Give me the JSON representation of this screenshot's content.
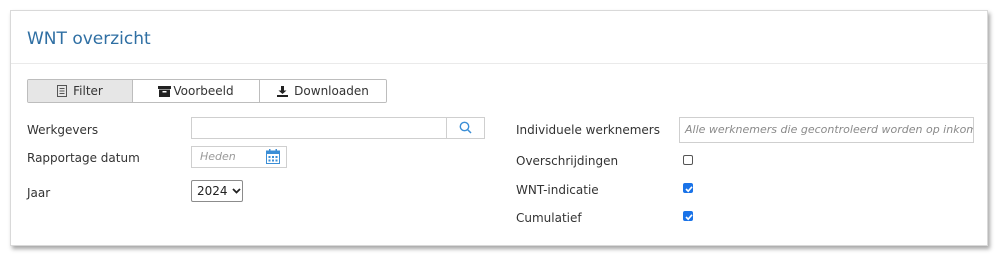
{
  "panel": {
    "title": "WNT overzicht"
  },
  "toolbar": {
    "filter_label": "Filter",
    "preview_label": "Voorbeeld",
    "download_label": "Downloaden"
  },
  "form": {
    "employers_label": "Werkgevers",
    "employers_value": "",
    "report_date_label": "Rapportage datum",
    "report_date_placeholder": "Heden",
    "year_label": "Jaar",
    "year_value": "2024",
    "individual_label": "Individuele werknemers",
    "individual_placeholder": "Alle werknemers die gecontroleerd worden op inkomen",
    "exceedances_label": "Overschrijdingen",
    "exceedances_checked": false,
    "wnt_indication_label": "WNT-indicatie",
    "wnt_indication_checked": true,
    "cumulative_label": "Cumulatief",
    "cumulative_checked": true
  },
  "colors": {
    "title": "#2f6fa3",
    "checkbox": "#1a73e8"
  },
  "icons": {
    "filter": "document-icon",
    "preview": "archive-icon",
    "download": "download-icon",
    "search": "search-icon",
    "calendar": "calendar-icon",
    "select": "chevron-down-icon"
  }
}
